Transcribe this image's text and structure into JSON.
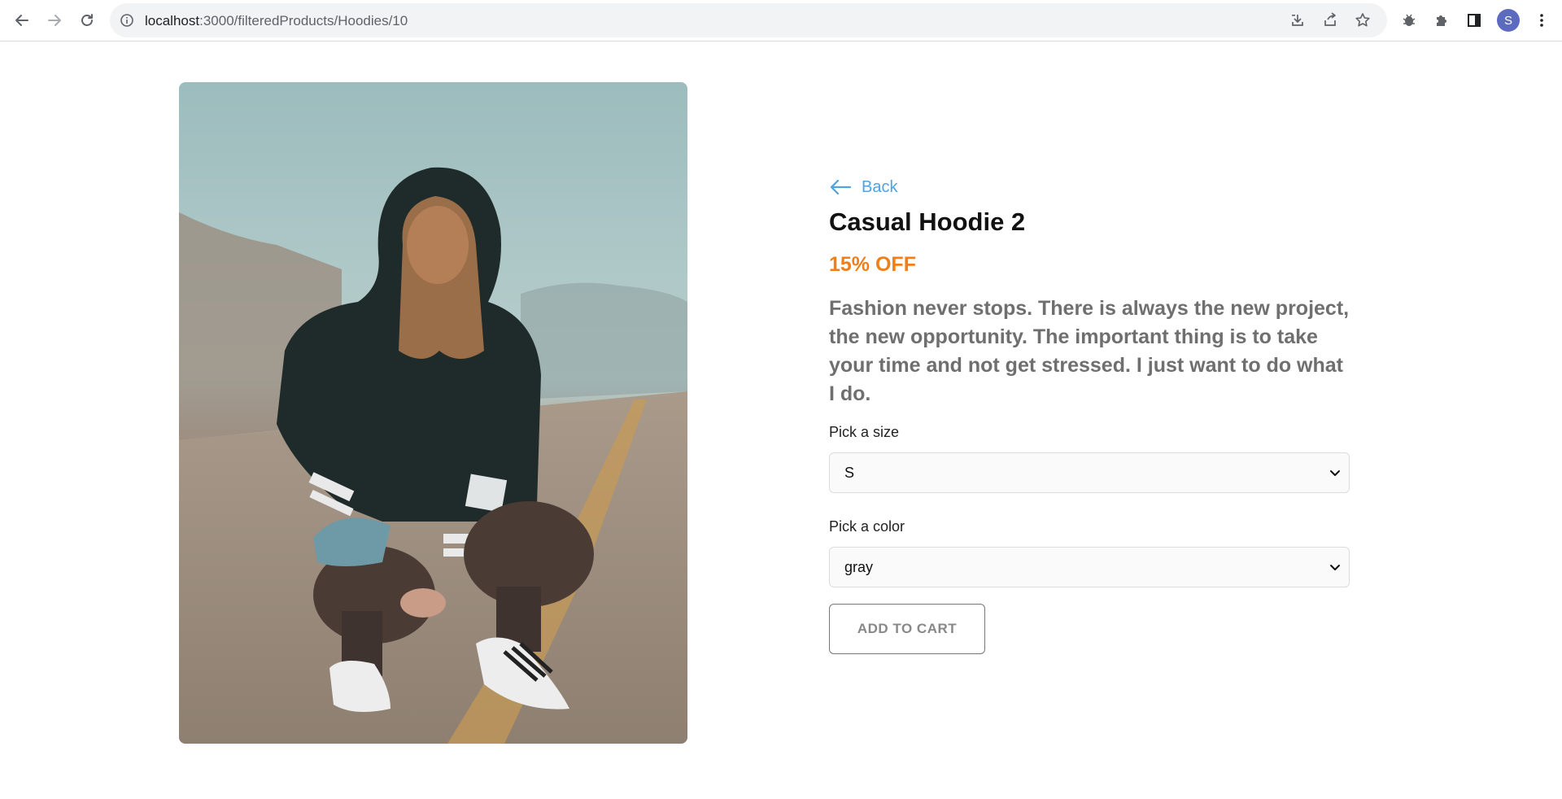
{
  "browser": {
    "url_host": "localhost",
    "url_path": ":3000/filteredProducts/Hoodies/10",
    "profile_initial": "S",
    "icons": [
      "back-icon",
      "forward-icon",
      "reload-icon",
      "site-info-icon",
      "install-icon",
      "share-icon",
      "bookmark-star-icon",
      "bug-extension-icon",
      "puzzle-extensions-icon",
      "side-panel-icon",
      "kebab-menu-icon"
    ]
  },
  "product": {
    "back_label": "Back",
    "title": "Casual Hoodie 2",
    "discount": "15% OFF",
    "description": "Fashion never stops. There is always the new project, the new opportunity. The important thing is to take your time and not get stressed. I just want to do what I do.",
    "size_label": "Pick a size",
    "size_value": "S",
    "color_label": "Pick a color",
    "color_value": "gray",
    "add_to_cart_label": "ADD TO CART"
  },
  "colors": {
    "accent_link": "#4ea3e0",
    "discount": "#f07f1a",
    "description": "#6f6f6f",
    "avatar": "#5c6bc0"
  }
}
